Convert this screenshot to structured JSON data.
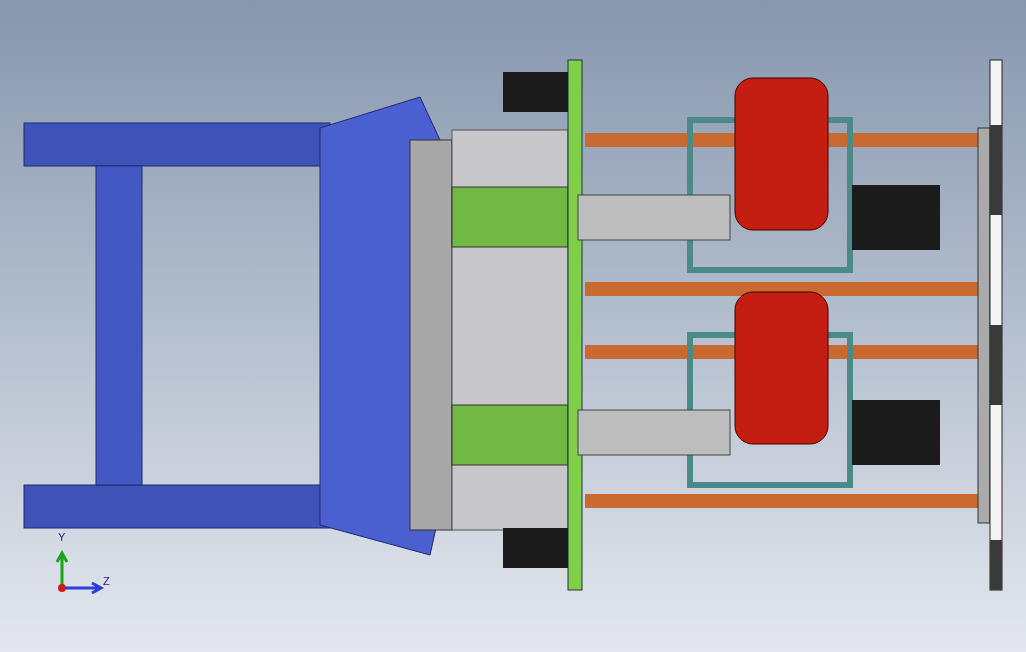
{
  "viewport": {
    "triad": {
      "axes": [
        {
          "label": "Y",
          "kind": "y"
        },
        {
          "label": "Z",
          "kind": "z"
        }
      ]
    }
  }
}
